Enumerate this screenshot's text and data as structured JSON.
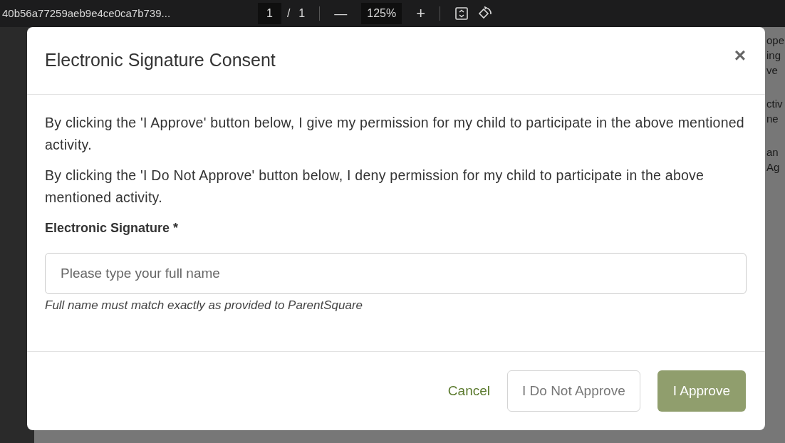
{
  "viewer": {
    "filename": "40b56a77259aeb9e4ce0ca7b739...",
    "page": "1",
    "page_separator": "/",
    "page_count": "1",
    "zoom_out": "—",
    "zoom": "125%",
    "zoom_in": "+"
  },
  "background_fragments": [
    [
      "ope",
      "ing",
      "ve"
    ],
    [
      "ctiv",
      "ne"
    ],
    [
      "an",
      "Ag"
    ]
  ],
  "dialog": {
    "title": "Electronic Signature Consent",
    "close": "×",
    "paragraphs": [
      "By clicking the 'I Approve' button below, I give my permission for my child to participate in the above mentioned activity.",
      "By clicking the 'I Do Not Approve' button below, I deny permission for my child to participate in the above mentioned activity."
    ],
    "field": {
      "label": "Electronic Signature *",
      "placeholder": "Please type your full name",
      "hint": "Full name must match exactly as provided to ParentSquare"
    },
    "buttons": [
      {
        "label": "Cancel",
        "kind": "link"
      },
      {
        "label": "I Do Not Approve",
        "kind": "outline"
      },
      {
        "label": "I Approve",
        "kind": "primary"
      }
    ]
  }
}
